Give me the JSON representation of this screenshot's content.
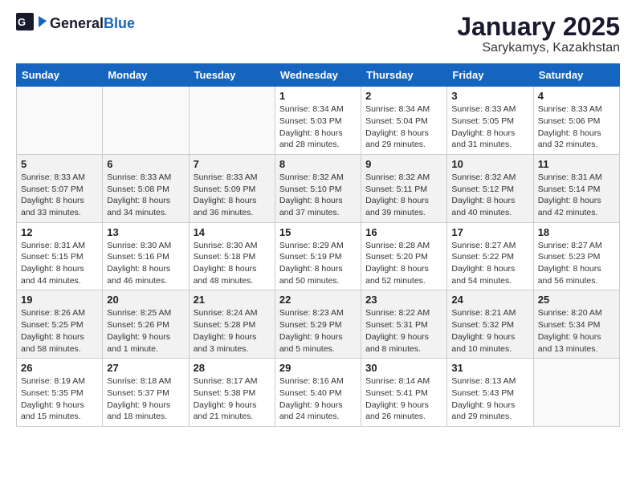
{
  "header": {
    "logo_general": "General",
    "logo_blue": "Blue",
    "title": "January 2025",
    "subtitle": "Sarykamys, Kazakhstan"
  },
  "weekdays": [
    "Sunday",
    "Monday",
    "Tuesday",
    "Wednesday",
    "Thursday",
    "Friday",
    "Saturday"
  ],
  "weeks": [
    [
      {
        "day": "",
        "info": ""
      },
      {
        "day": "",
        "info": ""
      },
      {
        "day": "",
        "info": ""
      },
      {
        "day": "1",
        "info": "Sunrise: 8:34 AM\nSunset: 5:03 PM\nDaylight: 8 hours\nand 28 minutes."
      },
      {
        "day": "2",
        "info": "Sunrise: 8:34 AM\nSunset: 5:04 PM\nDaylight: 8 hours\nand 29 minutes."
      },
      {
        "day": "3",
        "info": "Sunrise: 8:33 AM\nSunset: 5:05 PM\nDaylight: 8 hours\nand 31 minutes."
      },
      {
        "day": "4",
        "info": "Sunrise: 8:33 AM\nSunset: 5:06 PM\nDaylight: 8 hours\nand 32 minutes."
      }
    ],
    [
      {
        "day": "5",
        "info": "Sunrise: 8:33 AM\nSunset: 5:07 PM\nDaylight: 8 hours\nand 33 minutes."
      },
      {
        "day": "6",
        "info": "Sunrise: 8:33 AM\nSunset: 5:08 PM\nDaylight: 8 hours\nand 34 minutes."
      },
      {
        "day": "7",
        "info": "Sunrise: 8:33 AM\nSunset: 5:09 PM\nDaylight: 8 hours\nand 36 minutes."
      },
      {
        "day": "8",
        "info": "Sunrise: 8:32 AM\nSunset: 5:10 PM\nDaylight: 8 hours\nand 37 minutes."
      },
      {
        "day": "9",
        "info": "Sunrise: 8:32 AM\nSunset: 5:11 PM\nDaylight: 8 hours\nand 39 minutes."
      },
      {
        "day": "10",
        "info": "Sunrise: 8:32 AM\nSunset: 5:12 PM\nDaylight: 8 hours\nand 40 minutes."
      },
      {
        "day": "11",
        "info": "Sunrise: 8:31 AM\nSunset: 5:14 PM\nDaylight: 8 hours\nand 42 minutes."
      }
    ],
    [
      {
        "day": "12",
        "info": "Sunrise: 8:31 AM\nSunset: 5:15 PM\nDaylight: 8 hours\nand 44 minutes."
      },
      {
        "day": "13",
        "info": "Sunrise: 8:30 AM\nSunset: 5:16 PM\nDaylight: 8 hours\nand 46 minutes."
      },
      {
        "day": "14",
        "info": "Sunrise: 8:30 AM\nSunset: 5:18 PM\nDaylight: 8 hours\nand 48 minutes."
      },
      {
        "day": "15",
        "info": "Sunrise: 8:29 AM\nSunset: 5:19 PM\nDaylight: 8 hours\nand 50 minutes."
      },
      {
        "day": "16",
        "info": "Sunrise: 8:28 AM\nSunset: 5:20 PM\nDaylight: 8 hours\nand 52 minutes."
      },
      {
        "day": "17",
        "info": "Sunrise: 8:27 AM\nSunset: 5:22 PM\nDaylight: 8 hours\nand 54 minutes."
      },
      {
        "day": "18",
        "info": "Sunrise: 8:27 AM\nSunset: 5:23 PM\nDaylight: 8 hours\nand 56 minutes."
      }
    ],
    [
      {
        "day": "19",
        "info": "Sunrise: 8:26 AM\nSunset: 5:25 PM\nDaylight: 8 hours\nand 58 minutes."
      },
      {
        "day": "20",
        "info": "Sunrise: 8:25 AM\nSunset: 5:26 PM\nDaylight: 9 hours\nand 1 minute."
      },
      {
        "day": "21",
        "info": "Sunrise: 8:24 AM\nSunset: 5:28 PM\nDaylight: 9 hours\nand 3 minutes."
      },
      {
        "day": "22",
        "info": "Sunrise: 8:23 AM\nSunset: 5:29 PM\nDaylight: 9 hours\nand 5 minutes."
      },
      {
        "day": "23",
        "info": "Sunrise: 8:22 AM\nSunset: 5:31 PM\nDaylight: 9 hours\nand 8 minutes."
      },
      {
        "day": "24",
        "info": "Sunrise: 8:21 AM\nSunset: 5:32 PM\nDaylight: 9 hours\nand 10 minutes."
      },
      {
        "day": "25",
        "info": "Sunrise: 8:20 AM\nSunset: 5:34 PM\nDaylight: 9 hours\nand 13 minutes."
      }
    ],
    [
      {
        "day": "26",
        "info": "Sunrise: 8:19 AM\nSunset: 5:35 PM\nDaylight: 9 hours\nand 15 minutes."
      },
      {
        "day": "27",
        "info": "Sunrise: 8:18 AM\nSunset: 5:37 PM\nDaylight: 9 hours\nand 18 minutes."
      },
      {
        "day": "28",
        "info": "Sunrise: 8:17 AM\nSunset: 5:38 PM\nDaylight: 9 hours\nand 21 minutes."
      },
      {
        "day": "29",
        "info": "Sunrise: 8:16 AM\nSunset: 5:40 PM\nDaylight: 9 hours\nand 24 minutes."
      },
      {
        "day": "30",
        "info": "Sunrise: 8:14 AM\nSunset: 5:41 PM\nDaylight: 9 hours\nand 26 minutes."
      },
      {
        "day": "31",
        "info": "Sunrise: 8:13 AM\nSunset: 5:43 PM\nDaylight: 9 hours\nand 29 minutes."
      },
      {
        "day": "",
        "info": ""
      }
    ]
  ]
}
